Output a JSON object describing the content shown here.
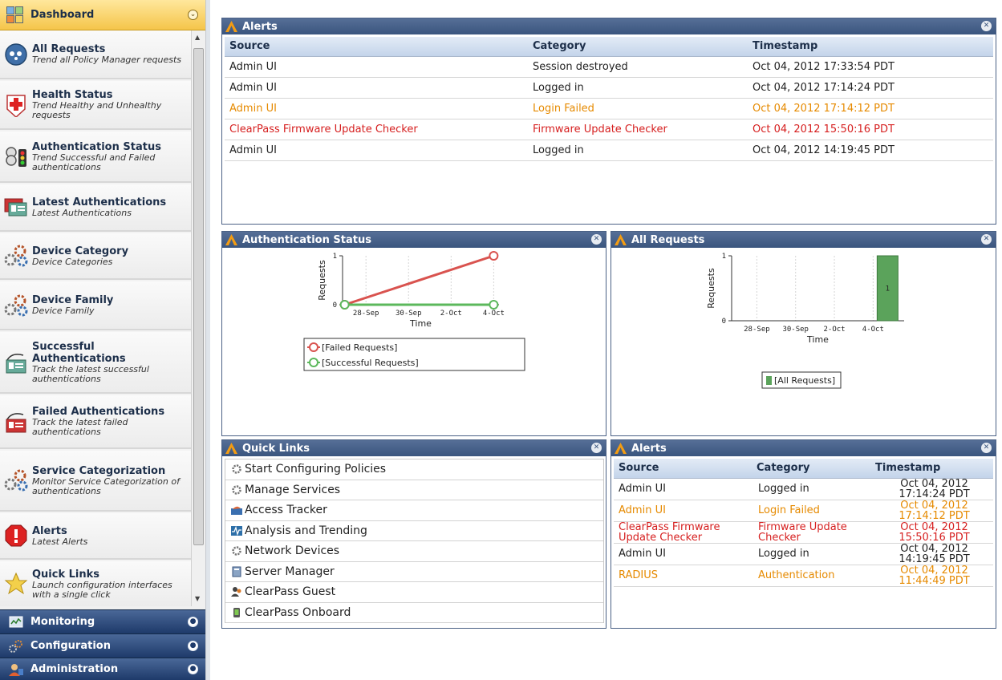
{
  "sidebar": {
    "header": {
      "label": "Dashboard",
      "icon": "dashboard-icon"
    },
    "items": [
      {
        "title": "All Requests",
        "subtitle": "Trend all Policy Manager requests",
        "icon": "requests-globe-icon"
      },
      {
        "title": "Health Status",
        "subtitle": "Trend Healthy and Unhealthy requests",
        "icon": "health-cross-icon"
      },
      {
        "title": "Authentication Status",
        "subtitle": "Trend Successful and Failed authentications",
        "icon": "auth-status-icon"
      },
      {
        "title": "Latest Authentications",
        "subtitle": "Latest Authentications",
        "icon": "id-card-icon"
      },
      {
        "title": "Device Category",
        "subtitle": "Device Categories",
        "icon": "gears-icon"
      },
      {
        "title": "Device Family",
        "subtitle": "Device Family",
        "icon": "gears-icon"
      },
      {
        "title": "Successful Authentications",
        "subtitle": "Track the latest successful authentications",
        "icon": "card-success-icon"
      },
      {
        "title": "Failed Authentications",
        "subtitle": "Track the latest failed authentications",
        "icon": "card-failed-icon"
      },
      {
        "title": "Service Categorization",
        "subtitle": "Monitor Service Categorization of authentications",
        "icon": "gears-icon"
      },
      {
        "title": "Alerts",
        "subtitle": "Latest Alerts",
        "icon": "alert-icon"
      },
      {
        "title": "Quick Links",
        "subtitle": "Launch configuration interfaces with a single click",
        "icon": "star-icon"
      }
    ],
    "nav": [
      {
        "label": "Monitoring",
        "icon": "monitoring-icon"
      },
      {
        "label": "Configuration",
        "icon": "configuration-icon"
      },
      {
        "label": "Administration",
        "icon": "administration-icon"
      }
    ]
  },
  "alerts_main": {
    "title": "Alerts",
    "columns": [
      "Source",
      "Category",
      "Timestamp"
    ],
    "rows": [
      {
        "source": "Admin UI",
        "category": "Session destroyed",
        "timestamp": "Oct 04, 2012 17:33:54 PDT",
        "severity": "ok"
      },
      {
        "source": "Admin UI",
        "category": "Logged in",
        "timestamp": "Oct 04, 2012 17:14:24 PDT",
        "severity": "ok"
      },
      {
        "source": "Admin UI",
        "category": "Login Failed",
        "timestamp": "Oct 04, 2012 17:14:12 PDT",
        "severity": "warn"
      },
      {
        "source": "ClearPass Firmware Update Checker",
        "category": "Firmware Update Checker",
        "timestamp": "Oct 04, 2012 15:50:16 PDT",
        "severity": "crit"
      },
      {
        "source": "Admin UI",
        "category": "Logged in",
        "timestamp": "Oct 04, 2012 14:19:45 PDT",
        "severity": "ok"
      }
    ]
  },
  "auth_status": {
    "title": "Authentication Status",
    "chart_data": {
      "type": "line",
      "xlabel": "Time",
      "ylabel": "Requests",
      "categories": [
        "28-Sep",
        "30-Sep",
        "2-Oct",
        "4-Oct"
      ],
      "ylim": [
        0,
        1
      ],
      "yticks": [
        "0",
        "1"
      ],
      "series": [
        {
          "name": "[Failed Requests]",
          "x": [
            "27-Sep",
            "4-Oct"
          ],
          "values": [
            0,
            1
          ],
          "color": "#d9534f"
        },
        {
          "name": "[Successful Requests]",
          "x": [
            "27-Sep",
            "4-Oct"
          ],
          "values": [
            0,
            0
          ],
          "color": "#5cb85c"
        }
      ],
      "legend_position": "bottom"
    }
  },
  "all_requests": {
    "title": "All Requests",
    "chart_data": {
      "type": "bar",
      "xlabel": "Time",
      "ylabel": "Requests",
      "categories": [
        "28-Sep",
        "30-Sep",
        "2-Oct",
        "4-Oct"
      ],
      "ylim": [
        0,
        1
      ],
      "yticks": [
        "0",
        "1"
      ],
      "series": [
        {
          "name": "[All Requests]",
          "x": [
            "4-Oct"
          ],
          "values": [
            1
          ],
          "data_labels": [
            "1"
          ],
          "color": "#5ba35b"
        }
      ],
      "legend_position": "bottom"
    }
  },
  "quick_links": {
    "title": "Quick Links",
    "items": [
      {
        "label": "Start Configuring Policies",
        "icon": "gear-icon"
      },
      {
        "label": "Manage Services",
        "icon": "gear-icon"
      },
      {
        "label": "Access Tracker",
        "icon": "access-tracker-icon"
      },
      {
        "label": "Analysis and Trending",
        "icon": "chart-icon"
      },
      {
        "label": "Network Devices",
        "icon": "gear-icon"
      },
      {
        "label": "Server Manager",
        "icon": "server-icon"
      },
      {
        "label": "ClearPass Guest",
        "icon": "guest-icon"
      },
      {
        "label": "ClearPass Onboard",
        "icon": "onboard-icon"
      }
    ]
  },
  "alerts_small": {
    "title": "Alerts",
    "columns": [
      "Source",
      "Category",
      "Timestamp"
    ],
    "rows": [
      {
        "source": "Admin UI",
        "category": "Logged in",
        "timestamp": "Oct 04, 2012 17:14:24 PDT",
        "severity": "ok"
      },
      {
        "source": "Admin UI",
        "category": "Login Failed",
        "timestamp": "Oct 04, 2012 17:14:12 PDT",
        "severity": "warn"
      },
      {
        "source": "ClearPass Firmware Update Checker",
        "category": "Firmware Update Checker",
        "timestamp": "Oct 04, 2012 15:50:16 PDT",
        "severity": "crit"
      },
      {
        "source": "Admin UI",
        "category": "Logged in",
        "timestamp": "Oct 04, 2012 14:19:45 PDT",
        "severity": "ok"
      },
      {
        "source": "RADIUS",
        "category": "Authentication",
        "timestamp": "Oct 04, 2012 11:44:49 PDT",
        "severity": "warn"
      }
    ]
  },
  "colors": {
    "panel_header": "#3a557e",
    "accent": "#f5c54a",
    "warn": "#e68a00",
    "crit": "#d61f1f"
  }
}
